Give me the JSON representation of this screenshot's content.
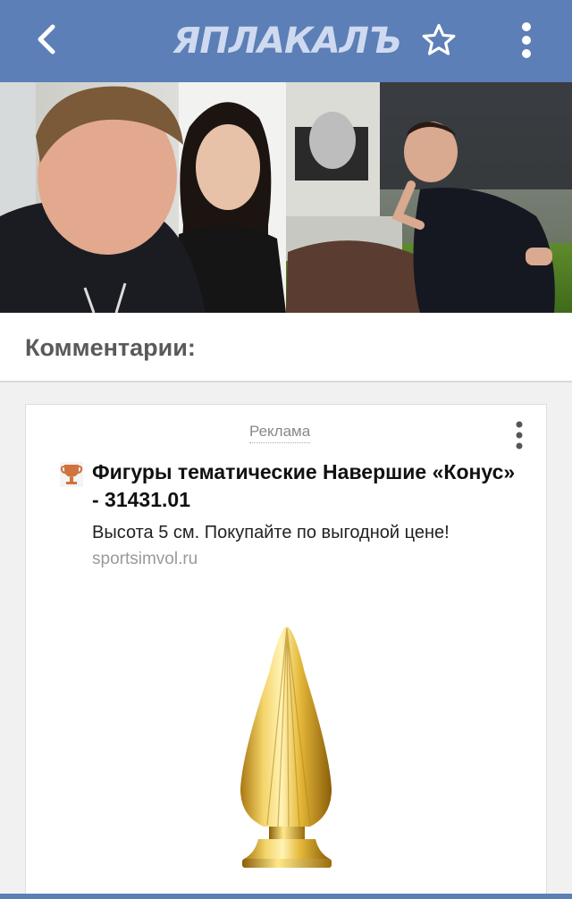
{
  "appbar": {
    "logo_text": "ЯПЛАКАЛЪ",
    "back_icon": "chevron-left-icon",
    "star_icon": "star-outline-icon",
    "more_icon": "more-vertical-icon",
    "color": "#5b7fb6"
  },
  "comments": {
    "title": "Комментарии:"
  },
  "ad": {
    "label": "Реклама",
    "title": "Фигуры тематические Навершие «Конус» - 31431.01",
    "description": "Высота 5 см. Покупайте по выгодной цене!",
    "domain": "sportsimvol.ru",
    "favicon": "trophy-icon",
    "image": "gold-cone-finial"
  }
}
